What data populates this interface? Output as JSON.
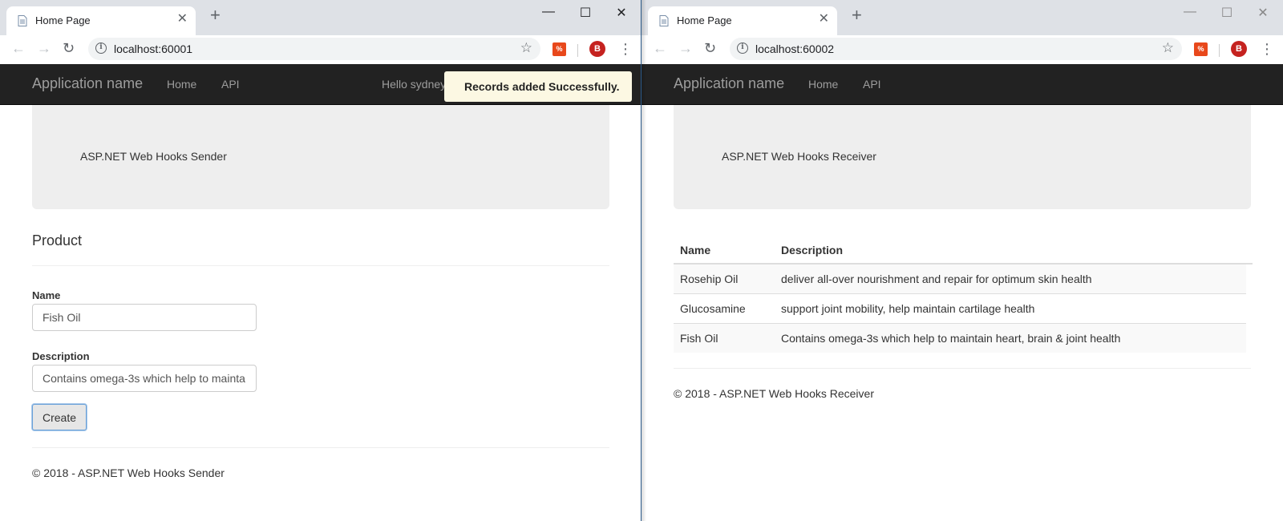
{
  "left_window": {
    "tab_title": "Home Page",
    "url": "localhost:60001",
    "avatar_letter": "B",
    "navbar": {
      "brand": "Application name",
      "links": [
        "Home",
        "API"
      ],
      "hello": "Hello sydney"
    },
    "toast": "Records added Successfully.",
    "jumbotron_text": "ASP.NET Web Hooks Sender",
    "form": {
      "heading": "Product",
      "name_label": "Name",
      "name_value": "Fish Oil",
      "description_label": "Description",
      "description_value": "Contains omega-3s which help to mainta",
      "create_label": "Create"
    },
    "footer": "© 2018 - ASP.NET Web Hooks Sender"
  },
  "right_window": {
    "tab_title": "Home Page",
    "url": "localhost:60002",
    "avatar_letter": "B",
    "navbar": {
      "brand": "Application name",
      "links": [
        "Home",
        "API"
      ]
    },
    "jumbotron_text": "ASP.NET Web Hooks Receiver",
    "table": {
      "headers": [
        "Name",
        "Description"
      ],
      "rows": [
        [
          "Rosehip Oil",
          "deliver all-over nourishment and repair for optimum skin health"
        ],
        [
          "Glucosamine",
          "support joint mobility, help maintain cartilage health"
        ],
        [
          "Fish Oil",
          "Contains omega-3s which help to maintain heart, brain & joint health"
        ]
      ]
    },
    "footer": "© 2018 - ASP.NET Web Hooks Receiver"
  },
  "icons": {
    "back": "←",
    "forward": "→",
    "reload": "↻",
    "star": "☆",
    "menu": "⋮",
    "close_tab": "✕",
    "new_tab": "+",
    "minimize": "—",
    "maximize": "☐",
    "close_window": "✕",
    "info": "i"
  },
  "colors": {
    "navbar_bg": "#222222",
    "toast_bg": "#fcf8e3",
    "avatar": "#c5221f",
    "extension": "#e8481b",
    "jumbotron_bg": "#eeeeee"
  }
}
